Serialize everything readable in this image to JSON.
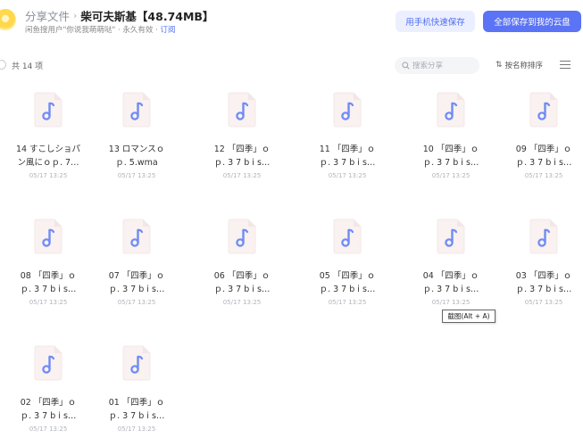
{
  "header": {
    "breadcrumb_root": "分享文件",
    "breadcrumb_sep": "›",
    "folder_title": "柴可夫斯基【48.74MB】",
    "share_info": "闲鱼搜用户\"你说我萌萌哒\" · 永久有效 · ",
    "subscribe_link": "订阅",
    "quick_save_label": "用手机快速保存",
    "save_all_label": "全部保存到我的云盘"
  },
  "toolbar": {
    "count_label": "共 14 项",
    "search_placeholder": "搜索分享",
    "sort_arrow": "⇅",
    "sort_label": "按名称排序"
  },
  "colors": {
    "accent": "#5b73f5",
    "icon_note": "#6f8cf6",
    "icon_bg": "#faf1f1"
  },
  "files": [
    {
      "line1": "14 すこしショパ",
      "line2": "ン風にｏｐ. 7…",
      "date": "05/17 13:25"
    },
    {
      "line1": "13 ロマンスｏ",
      "line2": "ｐ. 5.wma",
      "date": "05/17 13:25"
    },
    {
      "line1": "12 「四季」ｏ",
      "line2": "ｐ. 3 7 b i s…",
      "date": "05/17 13:25"
    },
    {
      "line1": "11 「四季」ｏ",
      "line2": "ｐ. 3 7 b i s…",
      "date": "05/17 13:25"
    },
    {
      "line1": "10 「四季」ｏ",
      "line2": "ｐ. 3 7 b i s…",
      "date": "05/17 13:25"
    },
    {
      "line1": "09 「四季」ｏ",
      "line2": "ｐ. 3 7 b i s…",
      "date": "05/17 13:25"
    },
    {
      "line1": "08 「四季」ｏ",
      "line2": "ｐ. 3 7 b i s…",
      "date": "05/17 13:25"
    },
    {
      "line1": "07 「四季」ｏ",
      "line2": "ｐ. 3 7 b i s…",
      "date": "05/17 13:25"
    },
    {
      "line1": "06 「四季」ｏ",
      "line2": "ｐ. 3 7 b i s…",
      "date": "05/17 13:25"
    },
    {
      "line1": "05 「四季」ｏ",
      "line2": "ｐ. 3 7 b i s…",
      "date": "05/17 13:25"
    },
    {
      "line1": "04 「四季」ｏ",
      "line2": "ｐ. 3 7 b i s…",
      "date": "05/17 13:25"
    },
    {
      "line1": "03 「四季」ｏ",
      "line2": "ｐ. 3 7 b i s…",
      "date": "05/17 13:25"
    },
    {
      "line1": "02 「四季」ｏ",
      "line2": "ｐ. 3 7 b i s…",
      "date": "05/17 13:25"
    },
    {
      "line1": "01 「四季」ｏ",
      "line2": "ｐ. 3 7 b i s…",
      "date": "05/17 13:25"
    }
  ],
  "tooltip": "截图(Alt + A)"
}
